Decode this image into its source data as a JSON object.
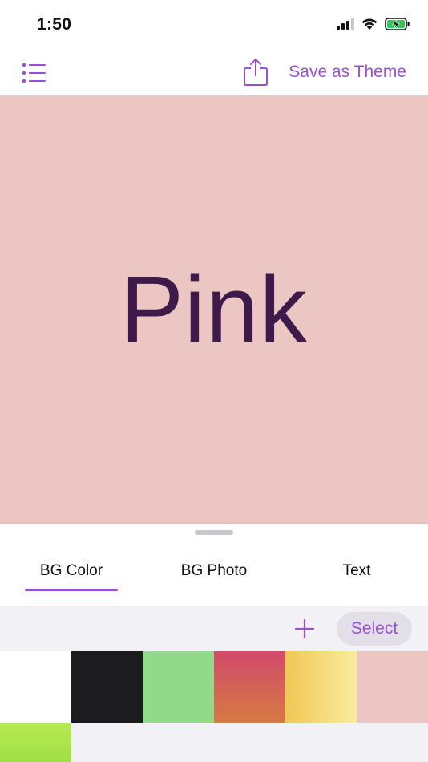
{
  "status_bar": {
    "time": "1:50",
    "icons": [
      "cellular-signal-icon",
      "wifi-icon",
      "battery-charging-icon"
    ]
  },
  "nav": {
    "menu_icon": "list-icon",
    "share_icon": "share-icon",
    "save_label": "Save as Theme"
  },
  "preview": {
    "text": "Pink",
    "background_color": "#ecc6c2",
    "text_color": "#3e1a4b"
  },
  "tabs": [
    {
      "label": "BG Color",
      "selected": true
    },
    {
      "label": "BG Photo",
      "selected": false
    },
    {
      "label": "Text",
      "selected": false
    }
  ],
  "toolbar": {
    "add_icon": "plus-icon",
    "select_label": "Select"
  },
  "swatches": [
    {
      "name": "white",
      "fill": "#ffffff"
    },
    {
      "name": "black",
      "fill": "#1c1c1e"
    },
    {
      "name": "green",
      "fill": "#90da8a"
    },
    {
      "name": "red-orange-gradient",
      "fill": "linear-gradient(180deg, #d24a6c 0%, #d67a42 100%)"
    },
    {
      "name": "yellow-gradient",
      "fill": "linear-gradient(90deg, #f0c855 0%, #f8ec9c 100%)"
    },
    {
      "name": "pink",
      "fill": "#ecc6c2"
    },
    {
      "name": "lime-gradient",
      "fill": "linear-gradient(180deg, #b6ea50 0%, #8ed640 100%)"
    }
  ],
  "colors": {
    "accent": "#9b4fd6",
    "toolbar_bg": "#f2f1f6"
  }
}
